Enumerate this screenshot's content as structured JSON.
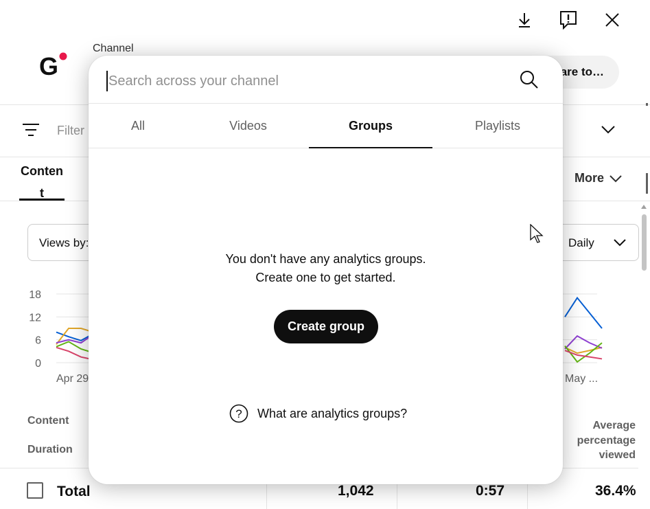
{
  "header": {
    "channel_label": "Channel",
    "share_label": "are to…",
    "icons": [
      "download-icon",
      "feedback-icon",
      "close-icon"
    ]
  },
  "filter": {
    "label": "Filter"
  },
  "content_tab": {
    "label": "Content"
  },
  "more_button": {
    "label": "More"
  },
  "views_by": {
    "label": "Views by:",
    "period": "Daily"
  },
  "chart_data": {
    "type": "line",
    "y_ticks": [
      "18",
      "12",
      "6",
      "0"
    ],
    "ylim": [
      0,
      18
    ],
    "x_labels_visible": [
      "Apr 29",
      "May ..."
    ],
    "grid": true,
    "colors": [
      "#065fd4",
      "#e1a72a",
      "#8e3fd1",
      "#63b515",
      "#d9446a"
    ]
  },
  "table": {
    "col_content": "Content",
    "col_duration": "Duration",
    "col_avg": "Average percentage viewed",
    "total_row": {
      "label": "Total",
      "views": "1,042",
      "avg_duration": "0:57",
      "avg_percent": "36.4%"
    }
  },
  "modal": {
    "search_placeholder": "Search across your channel",
    "tabs": [
      {
        "label": "All",
        "active": false
      },
      {
        "label": "Videos",
        "active": false
      },
      {
        "label": "Groups",
        "active": true
      },
      {
        "label": "Playlists",
        "active": false
      }
    ],
    "empty_line1": "You don't have any analytics groups.",
    "empty_line2": "Create one to get started.",
    "create_button": "Create group",
    "help_link": "What are analytics groups?"
  },
  "colors": {
    "accent": "#0f0f0f",
    "logo_dot": "#e8194b",
    "muted": "#606060"
  }
}
